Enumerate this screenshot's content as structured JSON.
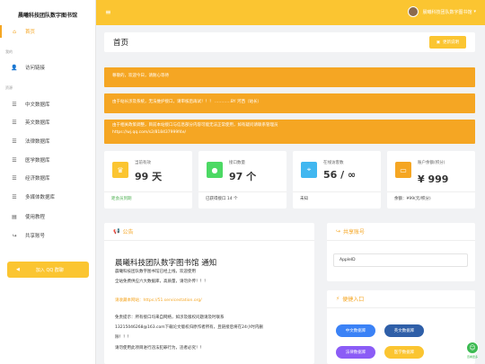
{
  "brand": "晨曦科技团队数字图书馆",
  "sidebar": {
    "home": "首页",
    "section_profile": "我的",
    "profile": "访问链接",
    "section_library": "资源",
    "items": [
      "中文数据库",
      "英文数据库",
      "法律数据库",
      "医学数据库",
      "经济数据库",
      "多媒体数据库",
      "使用教程",
      "共享账号"
    ],
    "qq_button": "加入 QQ 群聊"
  },
  "topbar": {
    "user_name": "晨曦科技团队数字图书馆"
  },
  "page": {
    "title": "首页",
    "about_button": "更新说明"
  },
  "banners": [
    "尊敬的，欢迎今日，请耐心等待",
    "由于站长涉及系统，无法维护接口，请审核后再试！！！ …………BY 河西（站长）",
    "由于相关政策调整，目前本站接口与信息部分内容可能无法正常使用，如有疑问请联系管理员",
    "https://wj.qq.com/s2/818437999f4e/"
  ],
  "cards": [
    {
      "label": "当前有效",
      "value": "99 天",
      "foot": "距会员到期",
      "color": "#fbc531",
      "icon": "crown-icon"
    },
    {
      "label": "接口数量",
      "value": "97 个",
      "foot": "已获得接口 14 个",
      "color": "#4cd964",
      "icon": "drop-icon"
    },
    {
      "label": "在线访客数",
      "value": "56 / ∞",
      "foot": "未知",
      "color": "#41b7f0",
      "icon": "location-icon"
    },
    {
      "label": "账户余额(积分)",
      "value": "¥ 999",
      "foot": "余额：¥99(元/积分)",
      "color": "#f5a623",
      "icon": "wallet-icon"
    }
  ],
  "notice": {
    "header": "公告",
    "title": "晨曦科技团队数字图书馆 通知",
    "lines": [
      "晨曦科技团队数字图书馆已经上线，欢迎使用",
      "全站免费供应六大数据库，高质量，请勿外传！！！",
      "",
      "请收藏本网站：https://51.servicestation.org/",
      "",
      "免责提示：所有接口均来自网络，如涉及版权问题请及时联系",
      "13215046268@163.com下载论文版权归原作者所有，且链接后将在24小时内删",
      "除！！！",
      "请勿使用此项目进行违法犯罪行为，违者必究！！"
    ]
  },
  "share": {
    "header": "共享账号",
    "item": "AppleID"
  },
  "quick": {
    "header": "便捷入口",
    "buttons": [
      "中文数据库",
      "英文数据库",
      "法律数据库",
      "医学数据库"
    ]
  },
  "fab_label": "查看更多"
}
